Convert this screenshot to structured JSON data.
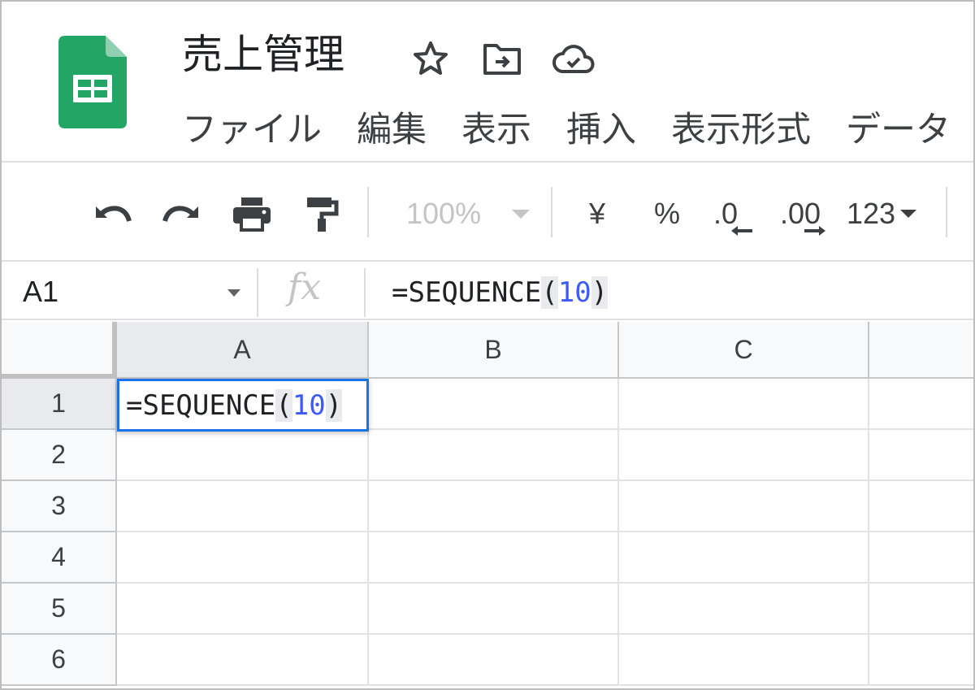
{
  "document": {
    "title": "売上管理"
  },
  "title_icons": [
    "star-icon",
    "move-folder-icon",
    "cloud-saved-icon"
  ],
  "menu": [
    "ファイル",
    "編集",
    "表示",
    "挿入",
    "表示形式",
    "データ"
  ],
  "toolbar": {
    "zoom": "100%",
    "currency": "¥",
    "percent": "%",
    "decrease_decimal": ".0",
    "increase_decimal": ".00",
    "more_formats": "123"
  },
  "formula_bar": {
    "cell_ref": "A1",
    "fx_label": "fx",
    "formula_prefix": "=SEQUENCE",
    "formula_open": "(",
    "formula_arg": "10",
    "formula_close": ")"
  },
  "grid": {
    "columns": [
      "A",
      "B",
      "C"
    ],
    "rows": [
      "1",
      "2",
      "3",
      "4",
      "5",
      "6"
    ],
    "active_column": "A",
    "active_row": "1",
    "editing_cell": {
      "ref": "A1",
      "prefix": "=SEQUENCE",
      "open": "(",
      "arg": "10",
      "close": ")"
    }
  },
  "colors": {
    "sheets_green": "#23a566",
    "selection_blue": "#1a73e8",
    "number_blue": "#3d5afe"
  }
}
